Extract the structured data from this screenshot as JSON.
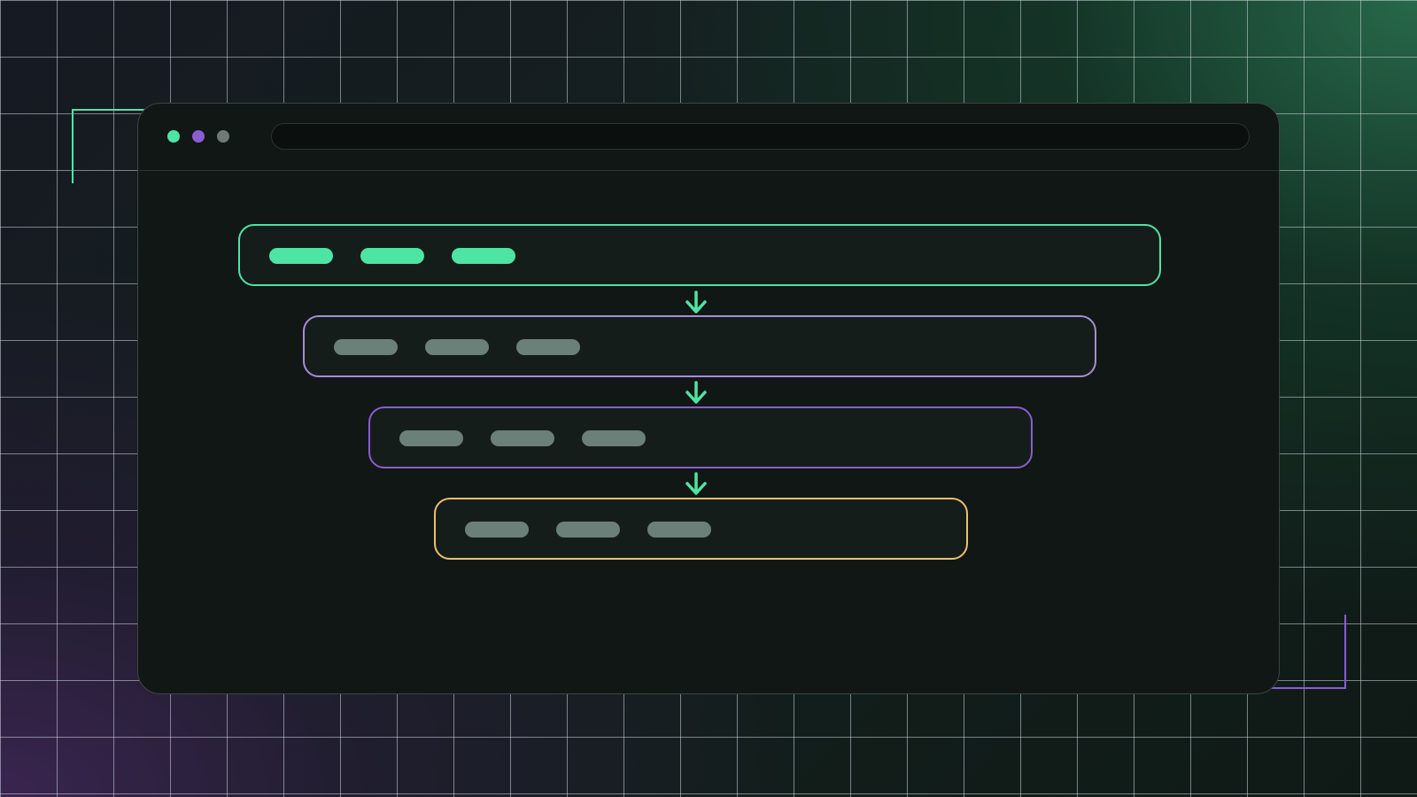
{
  "colors": {
    "green": "#4ee4a4",
    "lavender": "#a98bd8",
    "purple": "#8c5cd0",
    "amber": "#f0bf68",
    "muted_pill": "#6b8078",
    "gray_dot": "#6f7a76"
  },
  "window": {
    "traffic_lights": [
      {
        "icon": "green-dot-icon",
        "color": "#4ee4a4"
      },
      {
        "icon": "purple-dot-icon",
        "color": "#8c5cd0"
      },
      {
        "icon": "gray-dot-icon",
        "color": "#6f7a76"
      }
    ],
    "address_bar": ""
  },
  "stages": [
    {
      "border": "#4ee4a4",
      "pill_color": "#4ee4a4",
      "pills": 3
    },
    {
      "border": "#a98bd8",
      "pill_color": "#6b8078",
      "pills": 3
    },
    {
      "border": "#8c5cd0",
      "pill_color": "#6b8078",
      "pills": 3
    },
    {
      "border": "#f0bf68",
      "pill_color": "#6b8078",
      "pills": 3
    }
  ],
  "connectors": [
    {
      "icon": "arrow-down-icon",
      "color": "#4ee4a4"
    },
    {
      "icon": "arrow-down-icon",
      "color": "#4ee4a4"
    },
    {
      "icon": "arrow-down-icon",
      "color": "#4ee4a4"
    }
  ]
}
